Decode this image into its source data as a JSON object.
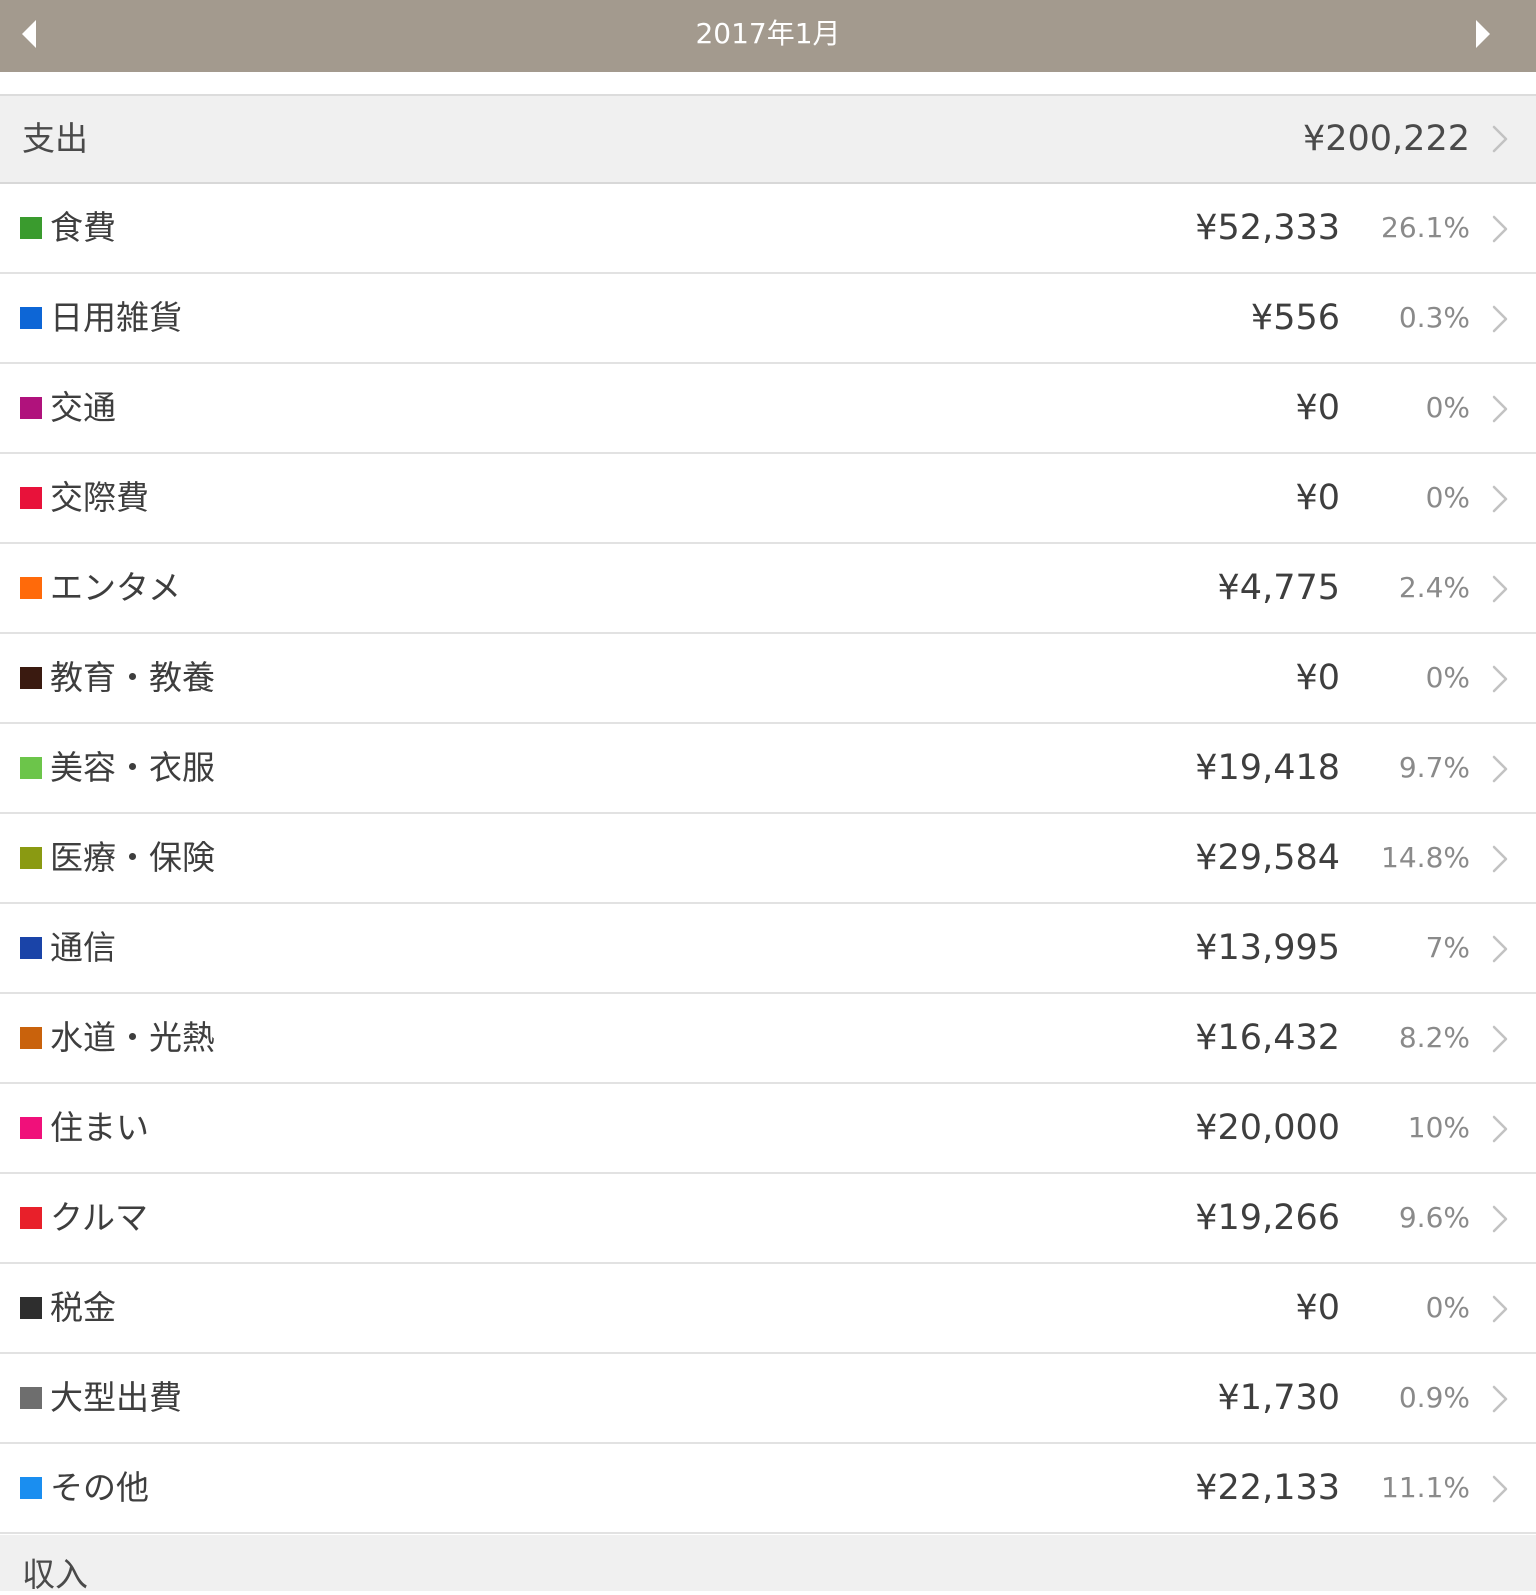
{
  "header": {
    "title": "2017年1月",
    "prev_icon": "triangle-left-icon",
    "next_icon": "triangle-right-icon"
  },
  "expense": {
    "label": "支出",
    "total": "¥200,222"
  },
  "categories": [
    {
      "name": "食費",
      "amount": "¥52,333",
      "percent": "26.1%",
      "color": "#3a9b2e"
    },
    {
      "name": "日用雑貨",
      "amount": "¥556",
      "percent": "0.3%",
      "color": "#0d66d6"
    },
    {
      "name": "交通",
      "amount": "¥0",
      "percent": "0%",
      "color": "#b0127c"
    },
    {
      "name": "交際費",
      "amount": "¥0",
      "percent": "0%",
      "color": "#e8123a"
    },
    {
      "name": "エンタメ",
      "amount": "¥4,775",
      "percent": "2.4%",
      "color": "#ff6a0a"
    },
    {
      "name": "教育・教養",
      "amount": "¥0",
      "percent": "0%",
      "color": "#3a1a10"
    },
    {
      "name": "美容・衣服",
      "amount": "¥19,418",
      "percent": "9.7%",
      "color": "#6cc54a"
    },
    {
      "name": "医療・保険",
      "amount": "¥29,584",
      "percent": "14.8%",
      "color": "#8a9a12"
    },
    {
      "name": "通信",
      "amount": "¥13,995",
      "percent": "7%",
      "color": "#1a44a8"
    },
    {
      "name": "水道・光熱",
      "amount": "¥16,432",
      "percent": "8.2%",
      "color": "#c9620c"
    },
    {
      "name": "住まい",
      "amount": "¥20,000",
      "percent": "10%",
      "color": "#f0107a"
    },
    {
      "name": "クルマ",
      "amount": "¥19,266",
      "percent": "9.6%",
      "color": "#e8202a"
    },
    {
      "name": "税金",
      "amount": "¥0",
      "percent": "0%",
      "color": "#2e2e2e"
    },
    {
      "name": "大型出費",
      "amount": "¥1,730",
      "percent": "0.9%",
      "color": "#6e6e6e"
    },
    {
      "name": "その他",
      "amount": "¥22,133",
      "percent": "11.1%",
      "color": "#1a8ef0"
    }
  ],
  "income": {
    "label": "収入"
  },
  "colors": {
    "nav_background": "#a39a8e",
    "section_background": "#f0f0f0"
  }
}
